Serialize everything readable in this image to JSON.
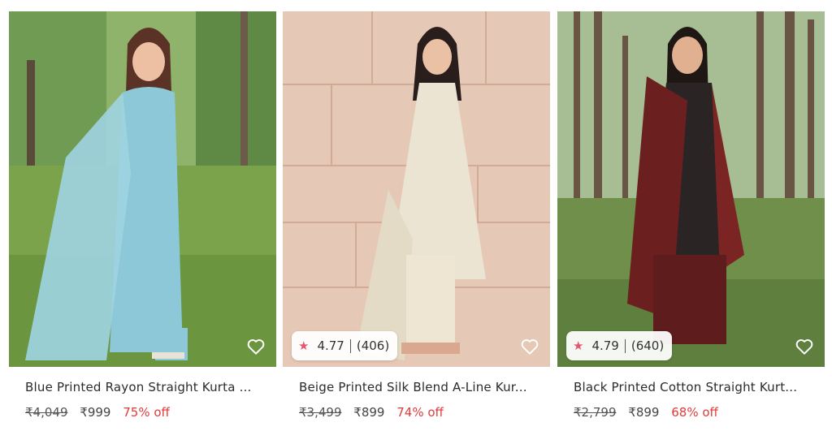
{
  "products": [
    {
      "title": "Blue Printed Rayon Straight Kurta ...",
      "mrp": "₹4,049",
      "price": "₹999",
      "discount": "75% off",
      "rating": null,
      "reviews": null,
      "colors": {
        "bg": "#7fa55e",
        "dress": "#8dc8d8",
        "ground": "#6f9a43"
      }
    },
    {
      "title": "Beige Printed Silk Blend A-Line Kur...",
      "mrp": "₹3,499",
      "price": "₹899",
      "discount": "74% off",
      "rating": "4.77",
      "reviews": "(406)",
      "colors": {
        "bg": "#e3c3b1",
        "dress": "#ece4d2",
        "ground": "#d8b6a3"
      }
    },
    {
      "title": "Black Printed Cotton Straight Kurt...",
      "mrp": "₹2,799",
      "price": "₹899",
      "discount": "68% off",
      "rating": "4.79",
      "reviews": "(640)",
      "colors": {
        "bg": "#9fb592",
        "dress": "#6b1f1f",
        "ground": "#6d8a4a"
      }
    }
  ],
  "icons": {
    "wishlist": "heart-outline-icon",
    "rating": "star-icon"
  },
  "accent": {
    "discount": "#e23a3a",
    "star": "#e5566b"
  }
}
